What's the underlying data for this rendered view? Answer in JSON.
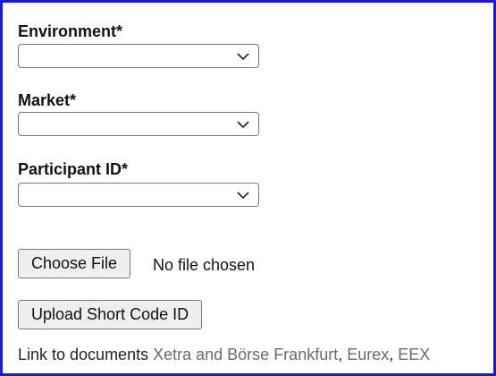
{
  "form": {
    "environment_label": "Environment*",
    "environment_value": "",
    "market_label": "Market*",
    "market_value": "",
    "participant_label": "Participant ID*",
    "participant_value": "",
    "choose_file_label": "Choose File",
    "file_status": "No file chosen",
    "upload_label": "Upload Short Code ID"
  },
  "documents": {
    "prefix": "Link to documents",
    "links": [
      "Xetra and Börse Frankfurt",
      "Eurex",
      "EEX"
    ],
    "separator": ", "
  },
  "colors": {
    "frame_border": "#1a1ad6",
    "link_text": "#6a6a6a"
  },
  "icons": {
    "dropdown": "chevron-down-icon"
  }
}
